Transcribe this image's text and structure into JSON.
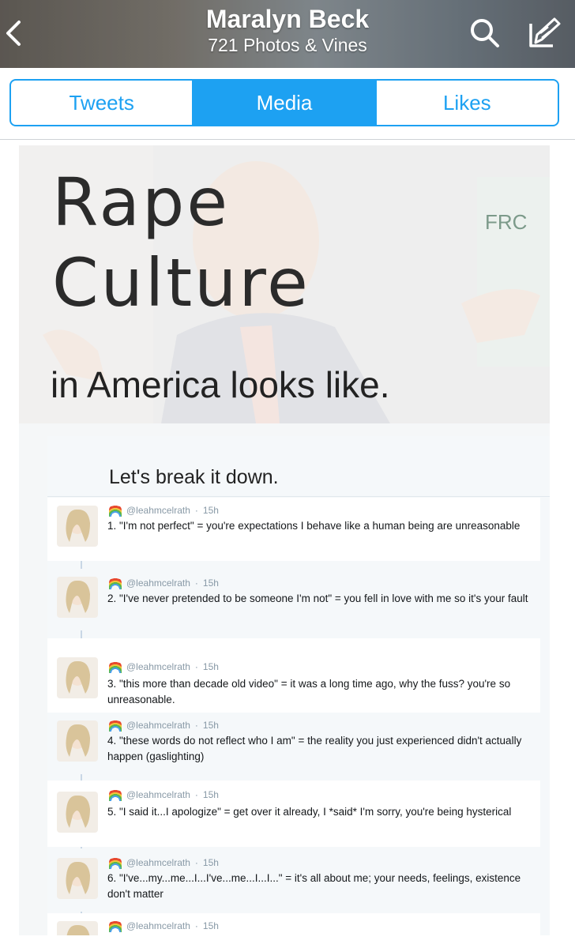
{
  "header": {
    "title": "Maralyn Beck",
    "subtitle": "721 Photos & Vines",
    "icons": {
      "back": "chevron-left-icon",
      "search": "search-icon",
      "compose": "compose-icon"
    }
  },
  "tabs": [
    {
      "label": "Tweets",
      "active": false
    },
    {
      "label": "Media",
      "active": true
    },
    {
      "label": "Likes",
      "active": false
    }
  ],
  "colors": {
    "accent": "#1da1f2"
  },
  "media": {
    "banner": {
      "line1": "Rape",
      "line2": "Culture",
      "line3": "in America looks like.",
      "background_sign": "FRC"
    },
    "screenshot": {
      "heading": "Let's break it down.",
      "tweets": [
        {
          "handle": "@leahmcelrath",
          "time": "15h",
          "text": "1. \"I'm not perfect\" = you're expectations I behave like a human being are unreasonable"
        },
        {
          "handle": "@leahmcelrath",
          "time": "15h",
          "text": "2. \"I've never pretended to be someone I'm not\" = you fell in love with me so it's your fault"
        },
        {
          "handle": "@leahmcelrath",
          "time": "15h",
          "text": "3. \"this more than decade old video\" = it was a long time ago, why the fuss? you're so unreasonable."
        },
        {
          "handle": "@leahmcelrath",
          "time": "15h",
          "text": "4. \"these words do not reflect who I am\" = the reality you just experienced didn't actually happen (gaslighting)"
        },
        {
          "handle": "@leahmcelrath",
          "time": "15h",
          "text": "5. \"I said it...I apologize\" = get over it already, I *said* I'm sorry, you're being hysterical"
        },
        {
          "handle": "@leahmcelrath",
          "time": "15h",
          "text": "6. \"I've...my...me...I...I've...me...I...I...\" = it's all about me; your needs, feelings, existence don't matter"
        },
        {
          "handle": "@leahmcelrath",
          "time": "15h",
          "text": ""
        }
      ]
    }
  }
}
